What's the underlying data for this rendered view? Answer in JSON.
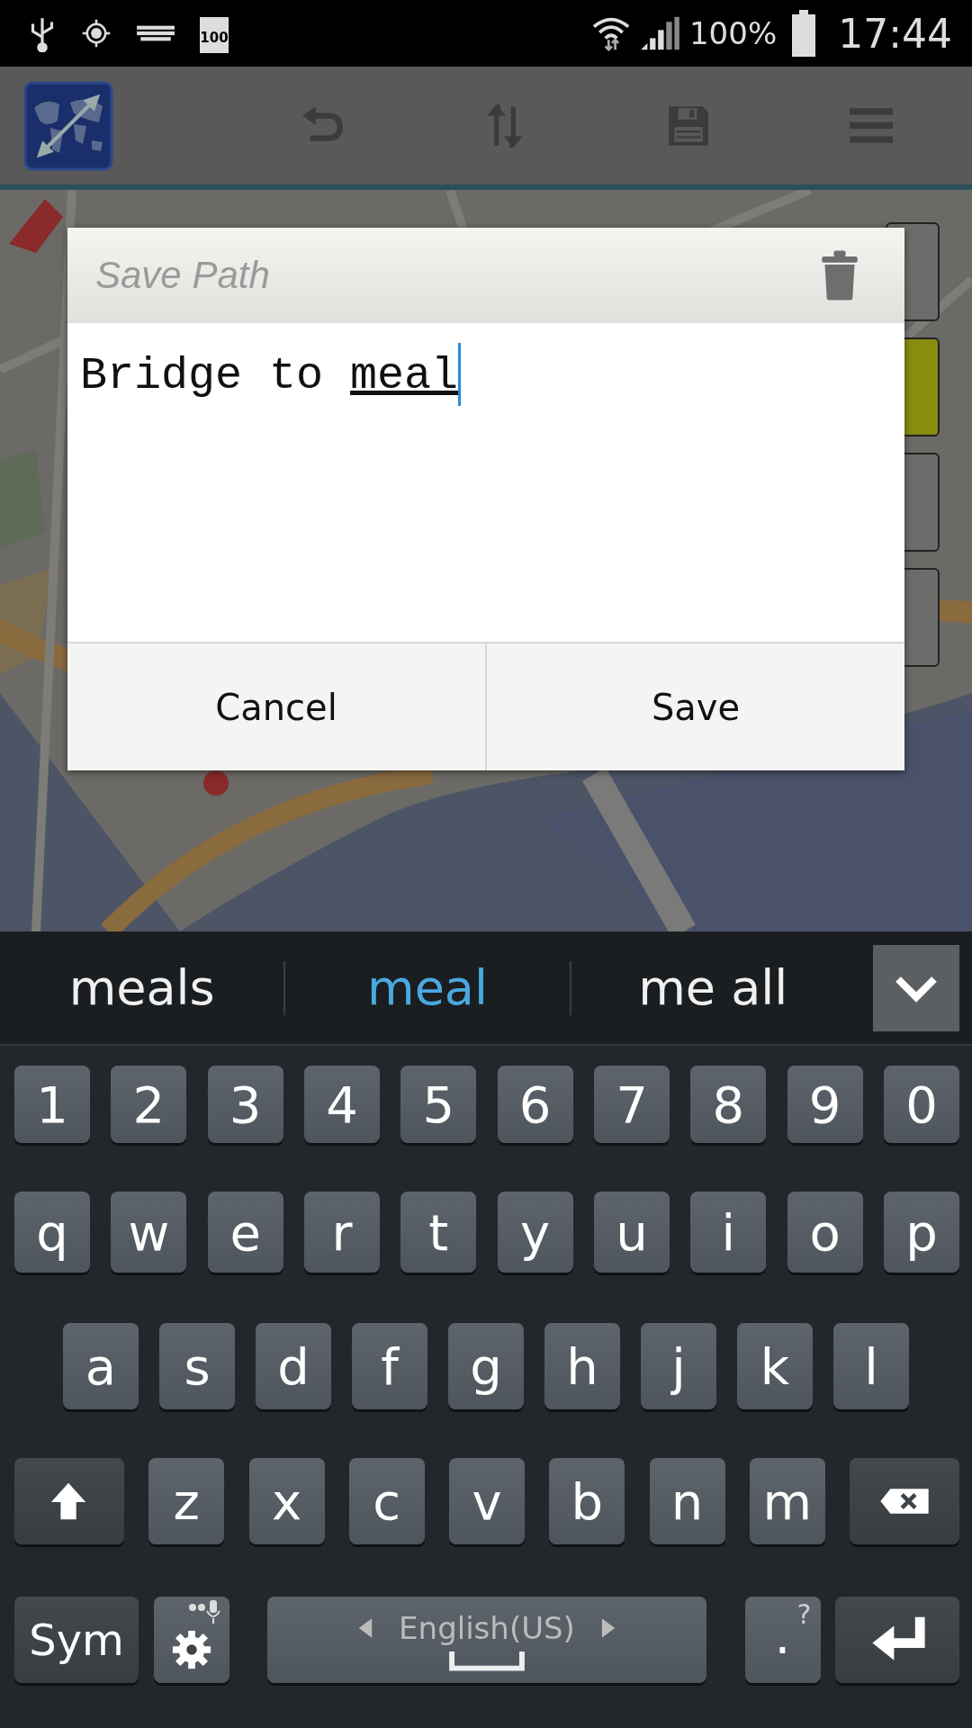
{
  "status_bar": {
    "battery_badge": "100",
    "battery_percent": "100%",
    "time": "17:44"
  },
  "toolbar": {
    "kind": "app"
  },
  "map": {
    "kind": "picture"
  },
  "map_buttons": [
    {
      "highlighted": false
    },
    {
      "highlighted": true
    },
    {
      "highlighted": false
    },
    {
      "highlighted": false
    }
  ],
  "dialog": {
    "title": "Save Path",
    "value": "Bridge to ",
    "composing": "meal",
    "buttons": [
      "Cancel",
      "Save"
    ]
  },
  "suggestions": [
    {
      "label": "meals",
      "selected": false
    },
    {
      "label": "meal",
      "selected": true
    },
    {
      "label": "me all",
      "selected": false
    }
  ],
  "keyboard": [
    [
      {
        "kind": "char",
        "label": "1"
      },
      {
        "kind": "char",
        "label": "2"
      },
      {
        "kind": "char",
        "label": "3"
      },
      {
        "kind": "char",
        "label": "4"
      },
      {
        "kind": "char",
        "label": "5"
      },
      {
        "kind": "char",
        "label": "6"
      },
      {
        "kind": "char",
        "label": "7"
      },
      {
        "kind": "char",
        "label": "8"
      },
      {
        "kind": "char",
        "label": "9"
      },
      {
        "kind": "char",
        "label": "0"
      }
    ],
    [
      {
        "kind": "char",
        "label": "q"
      },
      {
        "kind": "char",
        "label": "w"
      },
      {
        "kind": "char",
        "label": "e"
      },
      {
        "kind": "char",
        "label": "r"
      },
      {
        "kind": "char",
        "label": "t"
      },
      {
        "kind": "char",
        "label": "y"
      },
      {
        "kind": "char",
        "label": "u"
      },
      {
        "kind": "char",
        "label": "i"
      },
      {
        "kind": "char",
        "label": "o"
      },
      {
        "kind": "char",
        "label": "p"
      }
    ],
    [
      {
        "kind": "char",
        "label": "a"
      },
      {
        "kind": "char",
        "label": "s"
      },
      {
        "kind": "char",
        "label": "d"
      },
      {
        "kind": "char",
        "label": "f"
      },
      {
        "kind": "char",
        "label": "g"
      },
      {
        "kind": "char",
        "label": "h"
      },
      {
        "kind": "char",
        "label": "j"
      },
      {
        "kind": "char",
        "label": "k"
      },
      {
        "kind": "char",
        "label": "l"
      }
    ],
    [
      {
        "kind": "shift"
      },
      {
        "kind": "char",
        "label": "z"
      },
      {
        "kind": "char",
        "label": "x"
      },
      {
        "kind": "char",
        "label": "c"
      },
      {
        "kind": "char",
        "label": "v"
      },
      {
        "kind": "char",
        "label": "b"
      },
      {
        "kind": "char",
        "label": "n"
      },
      {
        "kind": "char",
        "label": "m"
      },
      {
        "kind": "backspace"
      }
    ],
    [
      {
        "kind": "sym",
        "label": "Sym"
      },
      {
        "kind": "settings"
      },
      {
        "kind": "space",
        "label": "English(US)"
      },
      {
        "kind": "punct",
        "label": ".",
        "hint": "?"
      },
      {
        "kind": "enter"
      }
    ]
  ]
}
